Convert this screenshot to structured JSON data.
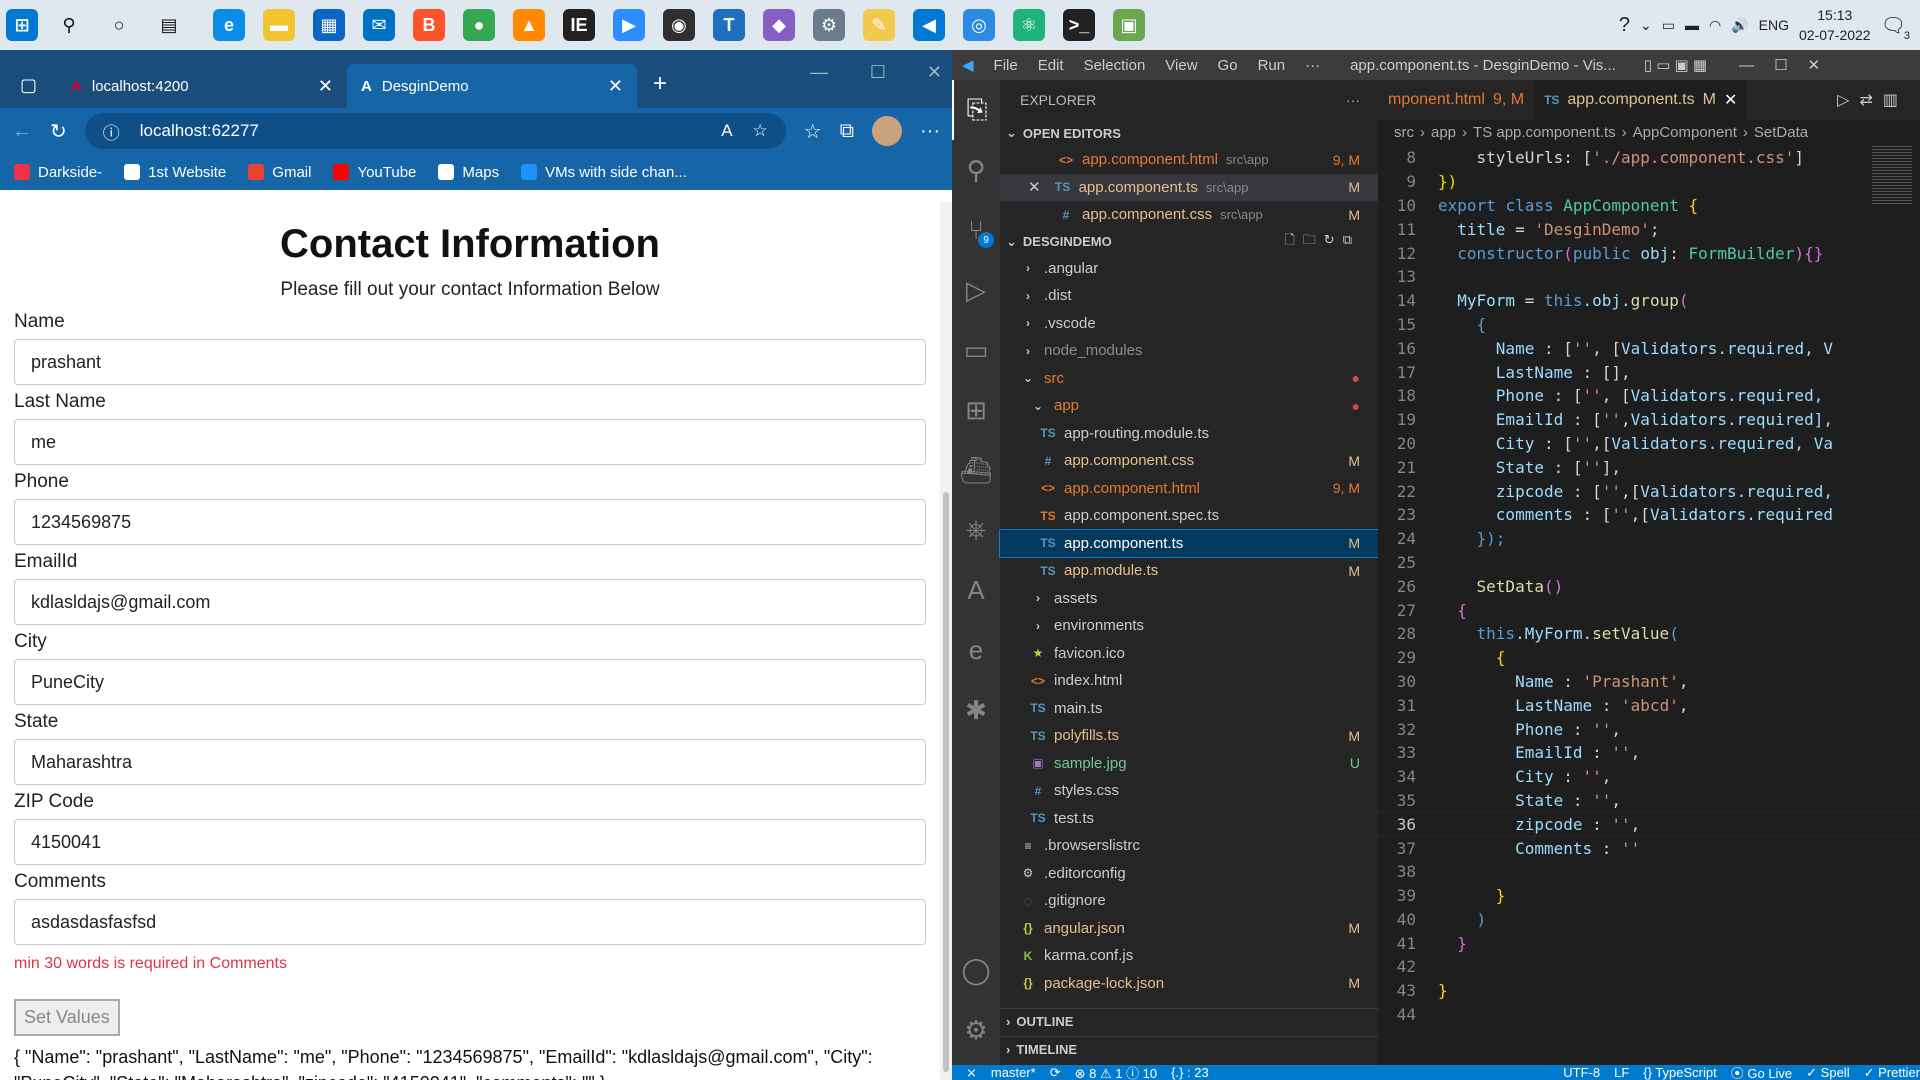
{
  "taskbar": {
    "lang": "ENG",
    "time": "15:13",
    "date": "02-07-2022",
    "notif": "3",
    "apps": [
      {
        "name": "windows-start-icon",
        "c": "#0078d4",
        "g": "⊞"
      },
      {
        "name": "search-icon",
        "c": "#dfe7ef",
        "g": "⚲"
      },
      {
        "name": "cortana-icon",
        "c": "#dfe7ef",
        "g": "○"
      },
      {
        "name": "task-view-icon",
        "c": "#dfe7ef",
        "g": "▤"
      },
      {
        "name": "edge-icon",
        "c": "#0c8ce9",
        "g": "e"
      },
      {
        "name": "file-explorer-icon",
        "c": "#f4c430",
        "g": "▬"
      },
      {
        "name": "ms-store-icon",
        "c": "#0a66c2",
        "g": "▦"
      },
      {
        "name": "mail-icon",
        "c": "#0072c6",
        "g": "✉"
      },
      {
        "name": "brave-icon",
        "c": "#fb542b",
        "g": "B"
      },
      {
        "name": "chrome-icon",
        "c": "#34a853",
        "g": "●"
      },
      {
        "name": "vlc-icon",
        "c": "#ff8800",
        "g": "▲"
      },
      {
        "name": "ie-icon",
        "c": "#222",
        "g": "IE"
      },
      {
        "name": "zoom-icon",
        "c": "#2d8cff",
        "g": "▶"
      },
      {
        "name": "obs-icon",
        "c": "#302e31",
        "g": "◉"
      },
      {
        "name": "teams-icon",
        "c": "#1e6fbf",
        "g": "T"
      },
      {
        "name": "visual-studio-icon",
        "c": "#865fc5",
        "g": "◆"
      },
      {
        "name": "settings-app-icon",
        "c": "#6b7b8c",
        "g": "⚙"
      },
      {
        "name": "paint-icon",
        "c": "#f2c94c",
        "g": "✎"
      },
      {
        "name": "vscode-taskbar-icon",
        "c": "#0078d4",
        "g": "◀"
      },
      {
        "name": "app-icon",
        "c": "#2b8ae2",
        "g": "◎"
      },
      {
        "name": "atom-icon",
        "c": "#1fb37a",
        "g": "⚛"
      },
      {
        "name": "terminal-icon",
        "c": "#222",
        "g": ">_"
      },
      {
        "name": "image-icon",
        "c": "#6aa84f",
        "g": "▣"
      }
    ]
  },
  "browser": {
    "tabs": [
      {
        "label": "localhost:4200"
      },
      {
        "label": "DesginDemo"
      }
    ],
    "url": "localhost:62277",
    "bookmarks": [
      {
        "label": "Darkside-",
        "c": "#e34"
      },
      {
        "label": "1st Website",
        "c": "#fff"
      },
      {
        "label": "Gmail",
        "c": "#ea4335"
      },
      {
        "label": "YouTube",
        "c": "#ff0000"
      },
      {
        "label": "Maps",
        "c": "#fff"
      },
      {
        "label": "VMs with side chan...",
        "c": "#1e90ff"
      }
    ]
  },
  "page": {
    "title": "Contact Information",
    "subtitle": "Please fill out your contact Information Below",
    "fields": [
      {
        "label": "Name",
        "value": "prashant"
      },
      {
        "label": "Last Name",
        "value": "me"
      },
      {
        "label": "Phone",
        "value": "1234569875"
      },
      {
        "label": "EmailId",
        "value": "kdlasldajs@gmail.com"
      },
      {
        "label": "City",
        "value": "PuneCity"
      },
      {
        "label": "State",
        "value": "Maharashtra"
      },
      {
        "label": "ZIP Code",
        "value": "4150041"
      },
      {
        "label": "Comments",
        "value": "asdasdasfasfsd"
      }
    ],
    "error": "min 30 words is required in Comments",
    "button": "Set Values",
    "json": "{ \"Name\": \"prashant\", \"LastName\": \"me\", \"Phone\": \"1234569875\", \"EmailId\": \"kdlasldajs@gmail.com\", \"City\": \"PuneCity\", \"State\": \"Maharashtra\", \"zipcode\": \"4150041\", \"comments\": \"\" }"
  },
  "vscode": {
    "menu": [
      "File",
      "Edit",
      "Selection",
      "View",
      "Go",
      "Run",
      "···"
    ],
    "title": "app.component.ts - DesginDemo - Vis...",
    "explorer": "EXPLORER",
    "open_editors": "OPEN EDITORS",
    "project": "DESGINDEMO",
    "outline": "OUTLINE",
    "timeline": "TIMELINE",
    "open": [
      {
        "icon": "<>",
        "ic": "#e37933",
        "name": "app.component.html",
        "path": "src\\app",
        "st": "9, M",
        "col": "#e37933"
      },
      {
        "icon": "TS",
        "ic": "#519aba",
        "name": "app.component.ts",
        "path": "src\\app",
        "st": "M",
        "col": "#e2c08d",
        "x": "✕"
      },
      {
        "icon": "#",
        "ic": "#519aba",
        "name": "app.component.css",
        "path": "src\\app",
        "st": "M",
        "col": "#e2c08d"
      }
    ],
    "tree": [
      {
        "ind": 20,
        "ic": "›",
        "icc": "#ccc",
        "name": ".angular",
        "col": "#ccc",
        "st": ""
      },
      {
        "ind": 20,
        "ic": "›",
        "icc": "#ccc",
        "name": ".dist",
        "col": "#ccc",
        "st": ""
      },
      {
        "ind": 20,
        "ic": "›",
        "icc": "#ccc",
        "name": ".vscode",
        "col": "#ccc",
        "st": ""
      },
      {
        "ind": 20,
        "ic": "›",
        "icc": "#ccc",
        "name": "node_modules",
        "col": "#8c8c8c",
        "st": ""
      },
      {
        "ind": 20,
        "ic": "⌄",
        "icc": "#ccc",
        "name": "src",
        "col": "#e37933",
        "st": "●",
        "stc": "#c74e39"
      },
      {
        "ind": 30,
        "ic": "⌄",
        "icc": "#ccc",
        "name": "app",
        "col": "#e37933",
        "st": "●",
        "stc": "#c74e39"
      },
      {
        "ind": 40,
        "ic": "TS",
        "icc": "#519aba",
        "name": "app-routing.module.ts",
        "col": "#ccc",
        "st": ""
      },
      {
        "ind": 40,
        "ic": "#",
        "icc": "#519aba",
        "name": "app.component.css",
        "col": "#e2c08d",
        "st": "M",
        "stc": "#e2c08d"
      },
      {
        "ind": 40,
        "ic": "<>",
        "icc": "#e37933",
        "name": "app.component.html",
        "col": "#e37933",
        "st": "9, M",
        "stc": "#e37933"
      },
      {
        "ind": 40,
        "ic": "TS",
        "icc": "#e37933",
        "name": "app.component.spec.ts",
        "col": "#ccc",
        "st": ""
      },
      {
        "ind": 40,
        "ic": "TS",
        "icc": "#519aba",
        "name": "app.component.ts",
        "col": "#fff",
        "st": "M",
        "stc": "#e2c08d",
        "sel": true
      },
      {
        "ind": 40,
        "ic": "TS",
        "icc": "#519aba",
        "name": "app.module.ts",
        "col": "#e2c08d",
        "st": "M",
        "stc": "#e2c08d"
      },
      {
        "ind": 30,
        "ic": "›",
        "icc": "#ccc",
        "name": "assets",
        "col": "#ccc",
        "st": ""
      },
      {
        "ind": 30,
        "ic": "›",
        "icc": "#ccc",
        "name": "environments",
        "col": "#ccc",
        "st": ""
      },
      {
        "ind": 30,
        "ic": "★",
        "icc": "#cbcb41",
        "name": "favicon.ico",
        "col": "#ccc",
        "st": ""
      },
      {
        "ind": 30,
        "ic": "<>",
        "icc": "#e37933",
        "name": "index.html",
        "col": "#ccc",
        "st": ""
      },
      {
        "ind": 30,
        "ic": "TS",
        "icc": "#519aba",
        "name": "main.ts",
        "col": "#ccc",
        "st": ""
      },
      {
        "ind": 30,
        "ic": "TS",
        "icc": "#519aba",
        "name": "polyfills.ts",
        "col": "#e2c08d",
        "st": "M",
        "stc": "#e2c08d"
      },
      {
        "ind": 30,
        "ic": "▣",
        "icc": "#a074c4",
        "name": "sample.jpg",
        "col": "#73c991",
        "st": "U",
        "stc": "#73c991"
      },
      {
        "ind": 30,
        "ic": "#",
        "icc": "#519aba",
        "name": "styles.css",
        "col": "#ccc",
        "st": ""
      },
      {
        "ind": 30,
        "ic": "TS",
        "icc": "#519aba",
        "name": "test.ts",
        "col": "#ccc",
        "st": ""
      },
      {
        "ind": 20,
        "ic": "≡",
        "icc": "#ccc",
        "name": ".browserslistrc",
        "col": "#ccc",
        "st": ""
      },
      {
        "ind": 20,
        "ic": "⚙",
        "icc": "#ccc",
        "name": ".editorconfig",
        "col": "#ccc",
        "st": ""
      },
      {
        "ind": 20,
        "ic": "◇",
        "icc": "#41535b",
        "name": ".gitignore",
        "col": "#ccc",
        "st": ""
      },
      {
        "ind": 20,
        "ic": "{}",
        "icc": "#cbcb41",
        "name": "angular.json",
        "col": "#e2c08d",
        "st": "M",
        "stc": "#e2c08d"
      },
      {
        "ind": 20,
        "ic": "K",
        "icc": "#8dc149",
        "name": "karma.conf.js",
        "col": "#ccc",
        "st": ""
      },
      {
        "ind": 20,
        "ic": "{}",
        "icc": "#cbcb41",
        "name": "package-lock.json",
        "col": "#e2c08d",
        "st": "M",
        "stc": "#e2c08d"
      }
    ],
    "etabs": [
      {
        "label": "mponent.html",
        "st": "9, M",
        "col": "#e37933"
      },
      {
        "label": "app.component.ts",
        "st": "M",
        "col": "#e2c08d",
        "icon": "TS"
      }
    ],
    "crumbs": [
      "src",
      "›",
      "app",
      "›",
      "TS app.component.ts",
      "›",
      "AppComponent",
      "›",
      "SetData"
    ],
    "code": [
      [
        8,
        [
          [
            "    styleUrls: [",
            "w"
          ],
          [
            "'./app.component.css'",
            "s"
          ],
          [
            "]",
            "w"
          ]
        ]
      ],
      [
        9,
        [
          [
            "})",
            "y"
          ]
        ]
      ],
      [
        10,
        [
          [
            "export ",
            "k"
          ],
          [
            "class ",
            "k"
          ],
          [
            "AppComponent ",
            "c"
          ],
          [
            "{",
            "y"
          ]
        ]
      ],
      [
        11,
        [
          [
            "  title ",
            "v"
          ],
          [
            "= ",
            "w"
          ],
          [
            "'DesginDemo'",
            "s"
          ],
          [
            ";",
            "w"
          ]
        ]
      ],
      [
        12,
        [
          [
            "  constructor",
            "k"
          ],
          [
            "(",
            "p"
          ],
          [
            "public ",
            "k"
          ],
          [
            "obj",
            "v"
          ],
          [
            ": ",
            "w"
          ],
          [
            "FormBuilder",
            "c"
          ],
          [
            "){}",
            "p"
          ]
        ]
      ],
      [
        13,
        [
          [
            "",
            "w"
          ]
        ]
      ],
      [
        14,
        [
          [
            "  MyForm ",
            "v"
          ],
          [
            "= ",
            "w"
          ],
          [
            "this",
            "k"
          ],
          [
            ".obj.",
            "v"
          ],
          [
            "group",
            "f"
          ],
          [
            "(",
            "p"
          ]
        ]
      ],
      [
        15,
        [
          [
            "    {",
            "k"
          ]
        ]
      ],
      [
        16,
        [
          [
            "      Name ",
            "v"
          ],
          [
            ": [",
            "w"
          ],
          [
            "''",
            "s"
          ],
          [
            ", [",
            "w"
          ],
          [
            "Validators",
            "v"
          ],
          [
            ".required, V",
            "v"
          ]
        ]
      ],
      [
        17,
        [
          [
            "      LastName ",
            "v"
          ],
          [
            ": [],",
            "w"
          ]
        ]
      ],
      [
        18,
        [
          [
            "      Phone ",
            "v"
          ],
          [
            ": [",
            "w"
          ],
          [
            "''",
            "s"
          ],
          [
            ", [",
            "w"
          ],
          [
            "Validators",
            "v"
          ],
          [
            ".required,",
            "v"
          ]
        ]
      ],
      [
        19,
        [
          [
            "      EmailId ",
            "v"
          ],
          [
            ": [",
            "w"
          ],
          [
            "''",
            "s"
          ],
          [
            ",",
            "w"
          ],
          [
            "Validators",
            "v"
          ],
          [
            ".required],",
            "v"
          ]
        ]
      ],
      [
        20,
        [
          [
            "      City ",
            "v"
          ],
          [
            ": [",
            "w"
          ],
          [
            "''",
            "s"
          ],
          [
            ",[",
            "w"
          ],
          [
            "Validators",
            "v"
          ],
          [
            ".required, Va",
            "v"
          ]
        ]
      ],
      [
        21,
        [
          [
            "      State ",
            "v"
          ],
          [
            ": [",
            "w"
          ],
          [
            "''",
            "s"
          ],
          [
            "],",
            "w"
          ]
        ]
      ],
      [
        22,
        [
          [
            "      zipcode ",
            "v"
          ],
          [
            ": [",
            "w"
          ],
          [
            "''",
            "s"
          ],
          [
            ",[",
            "w"
          ],
          [
            "Validators",
            "v"
          ],
          [
            ".required,",
            "v"
          ]
        ]
      ],
      [
        23,
        [
          [
            "      comments ",
            "v"
          ],
          [
            ": [",
            "w"
          ],
          [
            "''",
            "s"
          ],
          [
            ",[",
            "w"
          ],
          [
            "Validators",
            "v"
          ],
          [
            ".required",
            "v"
          ]
        ]
      ],
      [
        24,
        [
          [
            "    });",
            "k"
          ]
        ]
      ],
      [
        25,
        [
          [
            "",
            "w"
          ]
        ]
      ],
      [
        26,
        [
          [
            "    SetData",
            "f"
          ],
          [
            "()",
            "p"
          ]
        ]
      ],
      [
        27,
        [
          [
            "  {",
            "p"
          ]
        ]
      ],
      [
        28,
        [
          [
            "    this",
            "k"
          ],
          [
            ".MyForm.",
            "v"
          ],
          [
            "setValue",
            "f"
          ],
          [
            "(",
            "k"
          ]
        ]
      ],
      [
        29,
        [
          [
            "      {",
            "y"
          ]
        ]
      ],
      [
        30,
        [
          [
            "        Name ",
            "v"
          ],
          [
            ": ",
            "w"
          ],
          [
            "'Prashant'",
            "s"
          ],
          [
            ",",
            "w"
          ]
        ]
      ],
      [
        31,
        [
          [
            "        LastName ",
            "v"
          ],
          [
            ": ",
            "w"
          ],
          [
            "'abcd'",
            "s"
          ],
          [
            ",",
            "w"
          ]
        ]
      ],
      [
        32,
        [
          [
            "        Phone ",
            "v"
          ],
          [
            ": ",
            "w"
          ],
          [
            "''",
            "s"
          ],
          [
            ",",
            "w"
          ]
        ]
      ],
      [
        33,
        [
          [
            "        EmailId ",
            "v"
          ],
          [
            ": ",
            "w"
          ],
          [
            "''",
            "s"
          ],
          [
            ",",
            "w"
          ]
        ]
      ],
      [
        34,
        [
          [
            "        City ",
            "v"
          ],
          [
            ": ",
            "w"
          ],
          [
            "''",
            "s"
          ],
          [
            ",",
            "w"
          ]
        ]
      ],
      [
        35,
        [
          [
            "        State ",
            "v"
          ],
          [
            ": ",
            "w"
          ],
          [
            "''",
            "s"
          ],
          [
            ",",
            "w"
          ]
        ]
      ],
      [
        36,
        [
          [
            "        zipcode ",
            "v"
          ],
          [
            ": ",
            "w"
          ],
          [
            "''",
            "s"
          ],
          [
            ",",
            "w"
          ]
        ]
      ],
      [
        37,
        [
          [
            "        Comments ",
            "v"
          ],
          [
            ": ",
            "w"
          ],
          [
            "''",
            "s"
          ]
        ]
      ],
      [
        38,
        [
          [
            "",
            "w"
          ]
        ]
      ],
      [
        39,
        [
          [
            "      }",
            "y"
          ]
        ]
      ],
      [
        40,
        [
          [
            "    )",
            "k"
          ]
        ]
      ],
      [
        41,
        [
          [
            "  }",
            "p"
          ]
        ]
      ],
      [
        42,
        [
          [
            "",
            "w"
          ]
        ]
      ],
      [
        43,
        [
          [
            "}",
            "y"
          ]
        ]
      ],
      [
        44,
        [
          [
            "",
            "w"
          ]
        ]
      ]
    ],
    "status": [
      "⨯",
      "master*",
      "⟳",
      "⊗ 8 ⚠ 1 ⓘ 10",
      "{.} : 23",
      "UTF-8",
      "LF",
      "{} TypeScript",
      "⦿ Go Live",
      "✓ Spell",
      "✓ Prettier"
    ]
  }
}
